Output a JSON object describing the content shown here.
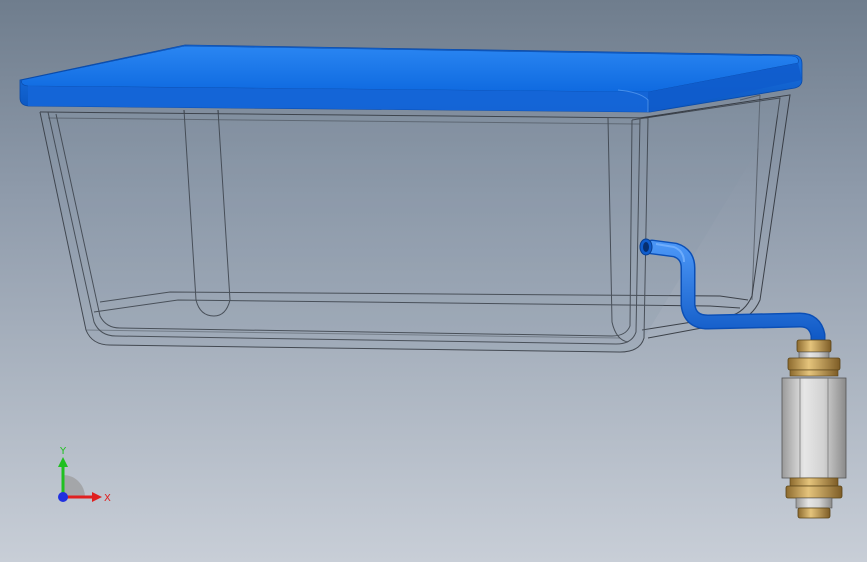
{
  "viewport": {
    "background_top": "#6f7d8d",
    "background_bottom": "#c8ced7"
  },
  "model": {
    "lid_color": "#1a73e8",
    "tube_color": "#1e6fd9",
    "container_style": "transparent-wireframe",
    "fitting_color": "#c9a25a",
    "valve_body_color": "#c8c8c8"
  },
  "triad": {
    "x_label": "X",
    "y_label": "Y",
    "x_color": "#e02020",
    "y_color": "#20c020",
    "z_color": "#2030e0"
  }
}
